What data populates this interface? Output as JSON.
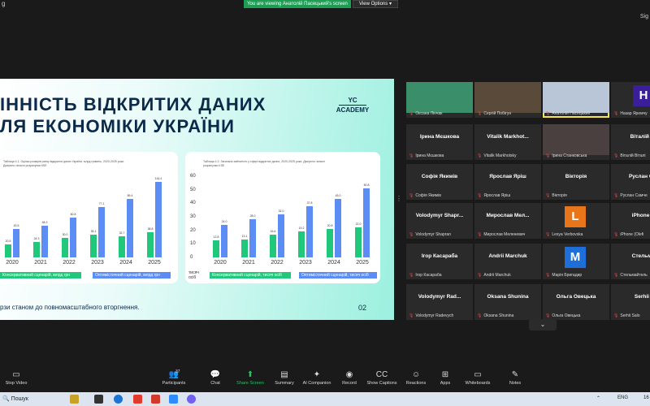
{
  "topbar": {
    "app_left": "g",
    "viewing_banner": "You are viewing Анатолій Пасецький's screen",
    "view_options": "View Options ▾",
    "sig": "Sig"
  },
  "slide": {
    "title_line1": "ІННІСТЬ ВІДКРИТИХ ДАНИХ",
    "title_line2": "ЛЯ ЕКОНОМІКИ УКРАЇНИ",
    "logo_line1": "YC",
    "logo_line2": "ACADEMY",
    "footer": "рзи станом до повномасштабного вторгнення.",
    "page": "02",
    "colors": {
      "green": "#21c77a",
      "blue": "#5b8df4"
    },
    "charts": [
      {
        "caption": "Таблиця 4.1. Оцінка розмірів ринку відкритих даних України, млрд гривень, 2020-2025 роки. Джерело: власні розрахунки КSE",
        "categories": [
          "2020",
          "2021",
          "2022",
          "2023",
          "2024",
          "2025"
        ],
        "series": [
          {
            "name": "Консервативний сценарій, млрд грн",
            "values": [
              20.5,
              24.3,
              30.0,
              35.1,
              32.7,
              38.8
            ]
          },
          {
            "name": "Оптимістичний сценарій, млрд грн",
            "values": [
              43.5,
              48.3,
              60.8,
              77.1,
              89.4,
              116.4
            ]
          }
        ],
        "value_labels": {
          "green": [
            "20.5",
            "24.3",
            "30.0",
            "35.1",
            "32.7",
            "38.8"
          ],
          "blue": [
            "43.5",
            "48.3",
            "60.8",
            "77.1",
            "89.4",
            "116.4"
          ]
        },
        "ymax": 125
      },
      {
        "caption": "Таблиця 4.2. Загальна зайнятість у сфері відкритих даних, 2020-2025 роки. Джерело: власні розрахунки KSE",
        "unit": "тисяч осіб",
        "yticks": [
          "0",
          "10",
          "20",
          "30",
          "40",
          "50",
          "60"
        ],
        "categories": [
          "2020",
          "2021",
          "2022",
          "2023",
          "2024",
          "2025"
        ],
        "series": [
          {
            "name": "Консервативний сценарій, тисяч осіб",
            "values": [
              12.8,
              13.1,
              16.6,
              19.2,
              20.8,
              22.0
            ]
          },
          {
            "name": "Оптимістичний сценарій, тисяч осіб",
            "values": [
              24.0,
              28.0,
              32.0,
              37.8,
              43.0,
              50.8
            ]
          }
        ],
        "value_labels": {
          "green": [
            "12.8",
            "13.1",
            "16.6",
            "19.2",
            "20.8",
            "22.0"
          ],
          "blue": [
            "24.0",
            "28.0",
            "32.0",
            "37.8",
            "43.0",
            "50.8"
          ]
        },
        "ymax": 60
      }
    ]
  },
  "gallery": {
    "tiles": [
      {
        "name": "",
        "label": "Оксана Лінчак",
        "kind": "photo",
        "color": "#3a8f6a"
      },
      {
        "name": "",
        "label": "Сергій Побігун",
        "kind": "photo",
        "color": "#5a4a3a"
      },
      {
        "name": "",
        "label": "Анатолій Пасецький",
        "kind": "photo",
        "color": "#b8c6d8"
      },
      {
        "name": "",
        "label": "Назар Яремчу",
        "kind": "avatar",
        "letter": "Н",
        "color": "#3b1e99"
      },
      {
        "name": "Ірина Мєшкова",
        "label": "Ірина Мєшкова",
        "kind": "text"
      },
      {
        "name": "Vitalik Markhot...",
        "label": "Vitalik Markhotsky",
        "kind": "text"
      },
      {
        "name": "",
        "label": "Ірина Станковська",
        "kind": "photo",
        "color": "#4a4040"
      },
      {
        "name": "Віталій Віт",
        "label": "Віталій Віталі",
        "kind": "text"
      },
      {
        "name": "Софія Якимів",
        "label": "Софія Якимів",
        "kind": "text"
      },
      {
        "name": "Ярослав Яріш",
        "label": "Ярослав Яріш",
        "kind": "text"
      },
      {
        "name": "Вікторія",
        "label": "Вікторія",
        "kind": "text"
      },
      {
        "name": "Руслан Сам",
        "label": "Руслан Самче",
        "kind": "text"
      },
      {
        "name": "Volodymyr Shapr...",
        "label": "Volodymyr Shapran",
        "kind": "text"
      },
      {
        "name": "Мирослав Мел...",
        "label": "Мирослав Меленевич",
        "kind": "text"
      },
      {
        "name": "",
        "label": "Lesya Verbovska",
        "kind": "avatar",
        "letter": "L",
        "color": "#e8751a"
      },
      {
        "name": "iPhone (O",
        "label": "iPhone (Olefi",
        "kind": "text"
      },
      {
        "name": "Ігор Касараба",
        "label": "Ігор Касараба",
        "kind": "text"
      },
      {
        "name": "Andrii Marchuk",
        "label": "Andrii Marchuk",
        "kind": "text"
      },
      {
        "name": "",
        "label": "Марія Бригадир",
        "kind": "avatar",
        "letter": "M",
        "color": "#1e6fd9"
      },
      {
        "name": "Стельмаг",
        "label": "Стельмайтель",
        "kind": "text"
      },
      {
        "name": "Volodymyr Rad...",
        "label": "Volodymyr Radevych",
        "kind": "text"
      },
      {
        "name": "Oksana Shunina",
        "label": "Oksana Shunina",
        "kind": "text"
      },
      {
        "name": "Ольга Овецька",
        "label": "Ольга Овецька",
        "kind": "text"
      },
      {
        "name": "Serhii S",
        "label": "Serhii Salo",
        "kind": "text"
      }
    ],
    "scroll_down": "⌄"
  },
  "toolbar": {
    "participants_count": "37",
    "buttons": [
      {
        "key": "stop-video",
        "label": "Stop Video",
        "icon": "▭"
      },
      {
        "key": "participants",
        "label": "Participants",
        "icon": "👥"
      },
      {
        "key": "chat",
        "label": "Chat",
        "icon": "💬"
      },
      {
        "key": "share-screen",
        "label": "Share Screen",
        "icon": "⬆"
      },
      {
        "key": "summary",
        "label": "Summary",
        "icon": "▤"
      },
      {
        "key": "ai-companion",
        "label": "AI Companion",
        "icon": "✦"
      },
      {
        "key": "record",
        "label": "Record",
        "icon": "◉"
      },
      {
        "key": "show-captions",
        "label": "Show Captions",
        "icon": "CC"
      },
      {
        "key": "reactions",
        "label": "Reactions",
        "icon": "☺"
      },
      {
        "key": "apps",
        "label": "Apps",
        "icon": "⊞"
      },
      {
        "key": "whiteboards",
        "label": "Whiteboards",
        "icon": "▭"
      },
      {
        "key": "notes",
        "label": "Notes",
        "icon": "✎"
      }
    ]
  },
  "taskbar": {
    "search": "Пошук",
    "lang": "ENG",
    "time": "16"
  }
}
